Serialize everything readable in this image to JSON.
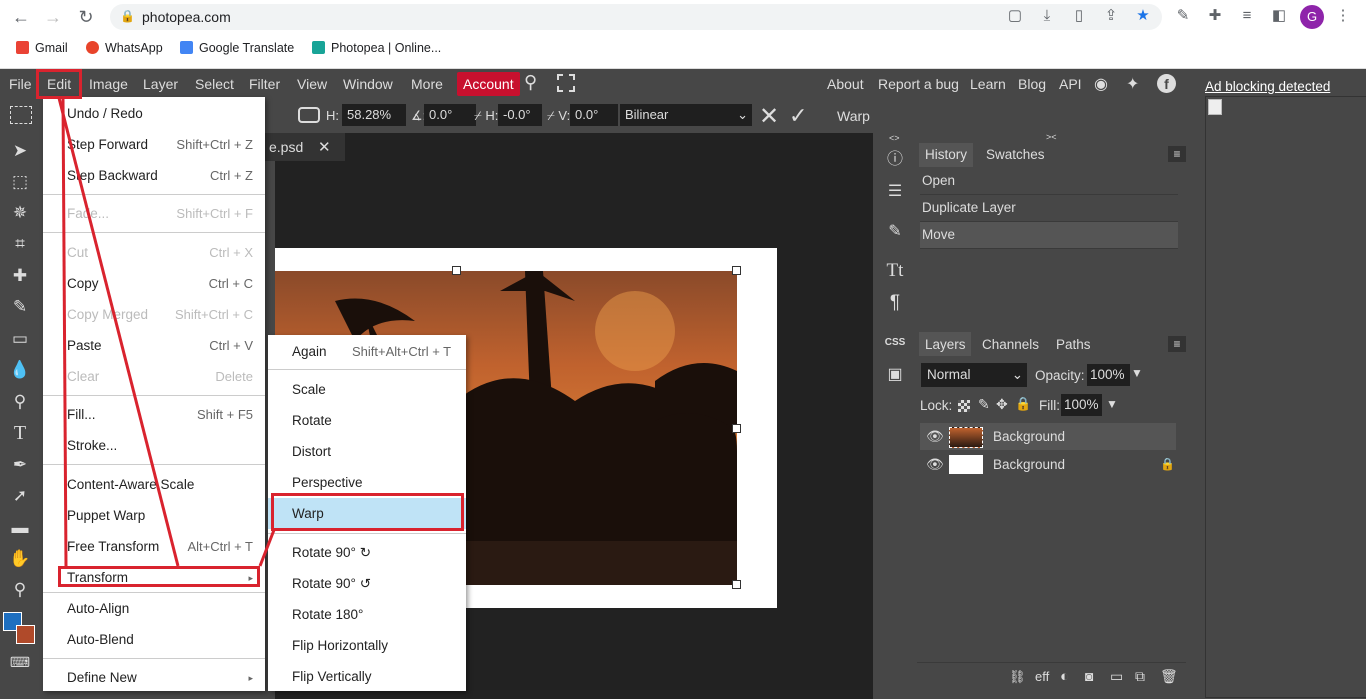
{
  "browser": {
    "url": "photopea.com",
    "bookmarks": [
      "Gmail",
      "WhatsApp",
      "Google Translate",
      "Photopea | Online..."
    ],
    "profile_initial": "G"
  },
  "menubar": {
    "items": [
      "File",
      "Edit",
      "Image",
      "Layer",
      "Select",
      "Filter",
      "View",
      "Window",
      "More"
    ],
    "account": "Account",
    "right_links": [
      "About",
      "Report a bug",
      "Learn",
      "Blog",
      "API"
    ]
  },
  "options_bar": {
    "h_label": "H:",
    "h_value": "58.28%",
    "angle_value": "0.0°",
    "skew_h_label": "H:",
    "skew_h_value": "-0.0°",
    "skew_v_label": "V:",
    "skew_v_value": "0.0°",
    "interpolation": "Bilinear",
    "warp_label": "Warp"
  },
  "document": {
    "tab_name": "e.psd"
  },
  "edit_menu": {
    "items": [
      {
        "label": "Undo / Redo",
        "shortcut": "",
        "disabled": false
      },
      {
        "label": "Step Forward",
        "shortcut": "Shift+Ctrl + Z",
        "disabled": false
      },
      {
        "label": "Step Backward",
        "shortcut": "Ctrl + Z",
        "disabled": false
      },
      {
        "label": "Fade...",
        "shortcut": "Shift+Ctrl + F",
        "disabled": true
      },
      {
        "label": "Cut",
        "shortcut": "Ctrl + X",
        "disabled": true
      },
      {
        "label": "Copy",
        "shortcut": "Ctrl + C",
        "disabled": false
      },
      {
        "label": "Copy Merged",
        "shortcut": "Shift+Ctrl + C",
        "disabled": true
      },
      {
        "label": "Paste",
        "shortcut": "Ctrl + V",
        "disabled": false
      },
      {
        "label": "Clear",
        "shortcut": "Delete",
        "disabled": true
      },
      {
        "label": "Fill...",
        "shortcut": "Shift + F5",
        "disabled": false
      },
      {
        "label": "Stroke...",
        "shortcut": "",
        "disabled": false
      },
      {
        "label": "Content-Aware Scale",
        "shortcut": "",
        "disabled": false
      },
      {
        "label": "Puppet Warp",
        "shortcut": "",
        "disabled": false
      },
      {
        "label": "Free Transform",
        "shortcut": "Alt+Ctrl + T",
        "disabled": false
      },
      {
        "label": "Transform",
        "shortcut": "▸",
        "disabled": false
      },
      {
        "label": "Auto-Align",
        "shortcut": "",
        "disabled": false
      },
      {
        "label": "Auto-Blend",
        "shortcut": "",
        "disabled": false
      },
      {
        "label": "Define New",
        "shortcut": "▸",
        "disabled": false
      }
    ]
  },
  "transform_menu": {
    "items": [
      {
        "label": "Again",
        "shortcut": "Shift+Alt+Ctrl + T"
      },
      {
        "label": "Scale",
        "shortcut": ""
      },
      {
        "label": "Rotate",
        "shortcut": ""
      },
      {
        "label": "Distort",
        "shortcut": ""
      },
      {
        "label": "Perspective",
        "shortcut": ""
      },
      {
        "label": "Warp",
        "shortcut": ""
      },
      {
        "label": "Rotate 90° ↻",
        "shortcut": ""
      },
      {
        "label": "Rotate 90° ↺",
        "shortcut": ""
      },
      {
        "label": "Rotate 180°",
        "shortcut": ""
      },
      {
        "label": "Flip Horizontally",
        "shortcut": ""
      },
      {
        "label": "Flip Vertically",
        "shortcut": ""
      }
    ]
  },
  "history_panel": {
    "tabs": [
      "History",
      "Swatches"
    ],
    "items": [
      "Open",
      "Duplicate Layer",
      "Move"
    ]
  },
  "layers_panel": {
    "tabs": [
      "Layers",
      "Channels",
      "Paths"
    ],
    "blend_mode": "Normal",
    "opacity_label": "Opacity:",
    "opacity": "100%",
    "lock_label": "Lock:",
    "fill_label": "Fill:",
    "fill": "100%",
    "layers": [
      "Background",
      "Background"
    ]
  },
  "ad": {
    "text": "Ad blocking detected"
  },
  "colors": {
    "accent_red": "#d9232e",
    "account_red": "#c8102e",
    "highlight": "#bfe3f6",
    "foreground": "#1e6fc0",
    "background_color": "#b04a2a"
  }
}
